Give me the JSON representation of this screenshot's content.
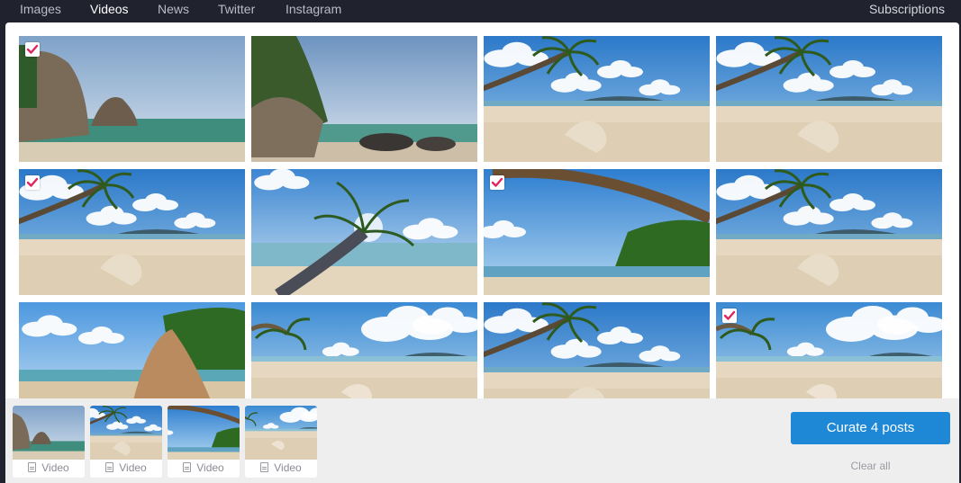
{
  "nav": {
    "tabs": [
      {
        "label": "Images",
        "active": false
      },
      {
        "label": "Videos",
        "active": true
      },
      {
        "label": "News",
        "active": false
      },
      {
        "label": "Twitter",
        "active": false
      },
      {
        "label": "Instagram",
        "active": false
      }
    ],
    "subscriptions_label": "Subscriptions"
  },
  "grid": {
    "items": [
      {
        "scene": "rocks-coast",
        "selected": true
      },
      {
        "scene": "rocks-shore",
        "selected": false
      },
      {
        "scene": "palm-left-beach",
        "selected": false
      },
      {
        "scene": "palm-left-beach-2",
        "selected": false
      },
      {
        "scene": "palm-left-beach",
        "selected": true
      },
      {
        "scene": "leaning-palm-sun",
        "selected": false
      },
      {
        "scene": "palm-canopy-green",
        "selected": true
      },
      {
        "scene": "palm-left-beach-2",
        "selected": false
      },
      {
        "scene": "rock-sand-green",
        "selected": false
      },
      {
        "scene": "clouds-beach",
        "selected": false
      },
      {
        "scene": "palm-left-beach",
        "selected": false
      },
      {
        "scene": "clouds-beach-2",
        "selected": true
      }
    ]
  },
  "tray": {
    "selected": [
      {
        "scene": "rocks-coast",
        "caption": "Video"
      },
      {
        "scene": "palm-left-beach",
        "caption": "Video"
      },
      {
        "scene": "palm-canopy-green",
        "caption": "Video"
      },
      {
        "scene": "clouds-beach-2",
        "caption": "Video"
      }
    ],
    "curate_label": "Curate 4 posts",
    "clear_label": "Clear all"
  },
  "colors": {
    "accent": "#1f88d6",
    "checkmark": "#e0245e",
    "nav_bg": "#20222e"
  }
}
